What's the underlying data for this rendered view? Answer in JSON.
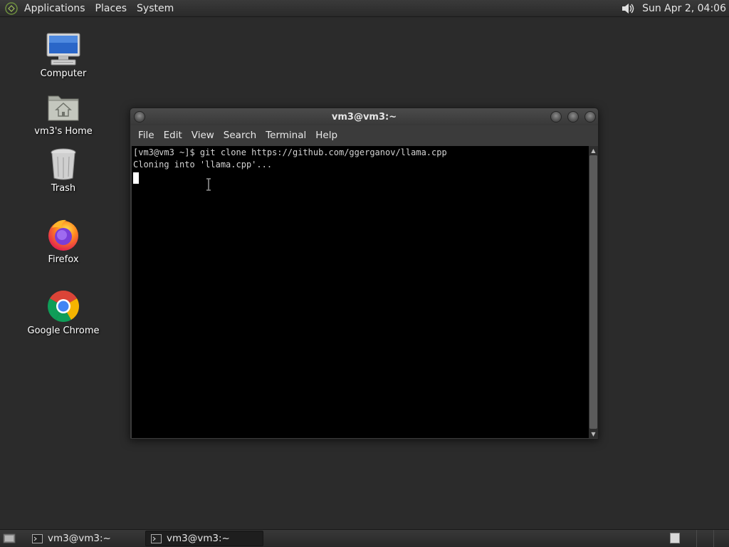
{
  "top_panel": {
    "menus": [
      "Applications",
      "Places",
      "System"
    ],
    "clock": "Sun Apr  2, 04:06"
  },
  "desktop": {
    "icons": [
      {
        "label": "Computer",
        "icon": "computer-icon"
      },
      {
        "label": "vm3's Home",
        "icon": "home-folder-icon"
      },
      {
        "label": "Trash",
        "icon": "trash-icon"
      },
      {
        "label": "Firefox",
        "icon": "firefox-icon"
      },
      {
        "label": "Google Chrome",
        "icon": "chrome-icon"
      }
    ]
  },
  "terminal": {
    "title": "vm3@vm3:~",
    "menu": [
      "File",
      "Edit",
      "View",
      "Search",
      "Terminal",
      "Help"
    ],
    "lines": [
      "[vm3@vm3 ~]$ git clone https://github.com/ggerganov/llama.cpp",
      "Cloning into 'llama.cpp'..."
    ]
  },
  "taskbar": {
    "tasks": [
      {
        "label": "vm3@vm3:~",
        "active": false
      },
      {
        "label": "vm3@vm3:~",
        "active": true
      }
    ]
  },
  "colors": {
    "desktop_bg": "#2b2b2b",
    "terminal_bg": "#000000",
    "terminal_fg": "#d4d4d4",
    "panel_bg": "#333333"
  }
}
